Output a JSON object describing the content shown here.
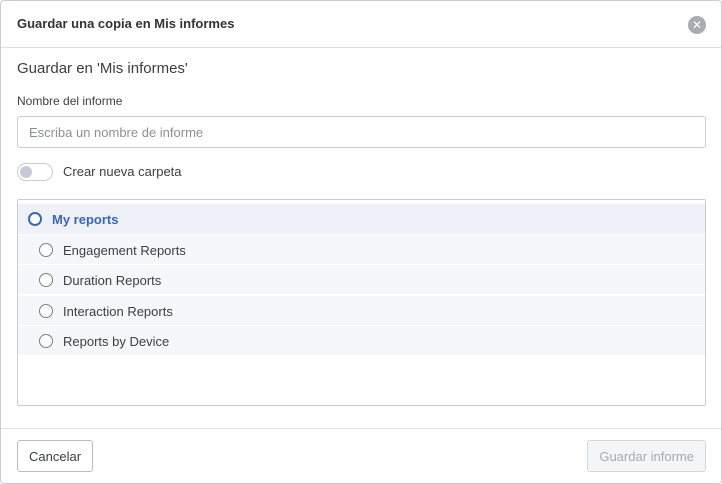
{
  "dialog": {
    "title": "Guardar una copia en Mis informes",
    "close_symbol": "✕",
    "close_icon": "close-icon"
  },
  "form": {
    "save_in_heading": "Guardar en 'Mis informes'",
    "name_label": "Nombre del informe",
    "name_value": "",
    "name_placeholder": "Escriba un nombre de informe",
    "new_folder_toggle_label": "Crear nueva carpeta",
    "new_folder_toggle_on": false
  },
  "folders": {
    "root": {
      "label": "My reports",
      "selected": true
    },
    "children": [
      {
        "label": "Engagement Reports",
        "selected": false
      },
      {
        "label": "Duration Reports",
        "selected": false
      },
      {
        "label": "Interaction Reports",
        "selected": false
      },
      {
        "label": "Reports by Device",
        "selected": false
      }
    ]
  },
  "footer": {
    "cancel_label": "Cancelar",
    "save_label": "Guardar informe",
    "save_enabled": false
  },
  "colors": {
    "accent": "#3a66b8",
    "row_root_bg": "#eef2f8",
    "row_child_bg": "#f5f7fa",
    "disabled_text": "#a6abb0"
  }
}
